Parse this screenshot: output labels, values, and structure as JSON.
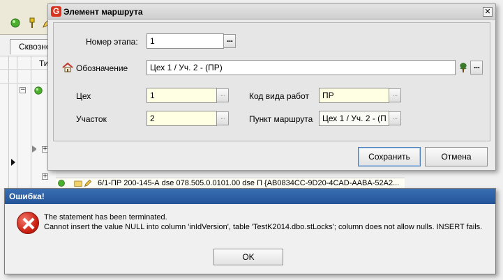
{
  "background": {
    "tab_label": "Сквозной",
    "header_fragment": "Ти",
    "row_text": "6/1-ПР 200-145-А dse  078.505.0.0101.00 dse  П  {AB0834CC-9D20-4CAD-AABA-52A2..."
  },
  "route_dialog": {
    "app_icon_letter": "G",
    "title": "Элемент маршрута",
    "close_symbol": "✕",
    "stage_number": {
      "label": "Номер этапа:",
      "value": "1"
    },
    "designation": {
      "label": "Обозначение",
      "value": "Цех 1 / Уч. 2 - (ПР)"
    },
    "workshop": {
      "label": "Цех",
      "value": "1"
    },
    "section": {
      "label": "Участок",
      "value": "2"
    },
    "work_type_code": {
      "label": "Код вида работ",
      "value": "ПР"
    },
    "route_point": {
      "label": "Пункт маршрута",
      "value": "Цех 1 / Уч. 2 - (П"
    },
    "ellipsis": "...",
    "save_label": "Сохранить",
    "cancel_label": "Отмена"
  },
  "error_dialog": {
    "title": "Ошибка!",
    "line1": "The statement has been terminated.",
    "line2": "Cannot insert the value NULL into column 'inIdVersion', table 'TestK2014.dbo.stLocks'; column does not allow nulls. INSERT fails.",
    "ok_label": "OK"
  },
  "icons": {
    "app": "app-logo-icon",
    "designation": "house-icon",
    "tree": "tree-icon",
    "error": "error-icon"
  }
}
